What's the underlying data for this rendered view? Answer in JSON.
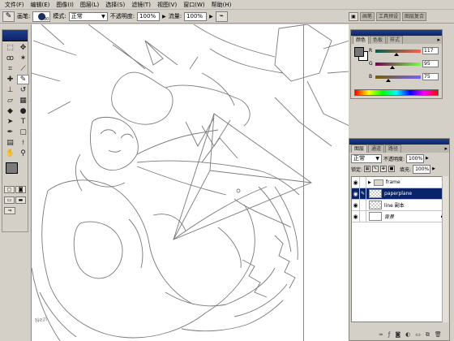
{
  "menu": [
    "文件(F)",
    "编辑(E)",
    "图像(I)",
    "图层(L)",
    "选择(S)",
    "滤镜(T)",
    "视图(V)",
    "窗口(W)",
    "帮助(H)"
  ],
  "options": {
    "brush_label": "画笔:",
    "brush_size": "30",
    "mode_label": "模式:",
    "mode_value": "正常",
    "opacity_label": "不透明度:",
    "opacity_value": "100%",
    "flow_label": "流量:",
    "flow_value": "100%"
  },
  "palette_well": [
    "画笔",
    "工具预设",
    "图层复合"
  ],
  "color_panel": {
    "tabs": [
      "颜色",
      "色板",
      "样式"
    ],
    "r_label": "R",
    "r_value": "117",
    "r_fraction": 0.459,
    "g_label": "G",
    "g_value": "95",
    "g_fraction": 0.373,
    "b_label": "B",
    "b_value": "75",
    "b_fraction": 0.294
  },
  "layers_panel": {
    "tabs": [
      "图层",
      "通道",
      "路径"
    ],
    "blend_mode": "正常",
    "opacity_label": "不透明度:",
    "opacity_value": "100%",
    "lock_label": "锁定:",
    "fill_label": "填充:",
    "fill_value": "100%",
    "layers": [
      {
        "name": "frame",
        "kind": "folder",
        "active": false
      },
      {
        "name": "paperplane",
        "kind": "layer",
        "active": true
      },
      {
        "name": "line 副本",
        "kind": "layer",
        "active": false
      },
      {
        "name": "背景",
        "kind": "background",
        "active": false
      }
    ]
  },
  "canvas": {
    "signature": "Nezi"
  },
  "colors": {
    "titlebar": "#0a246a",
    "chrome": "#d4d0c8",
    "selected_layer": "#0a246a",
    "foreground": "#757575"
  },
  "icons": [
    "brush-icon",
    "airbrush-icon",
    "eye-icon",
    "folder-icon",
    "lock-icon",
    "trash-icon"
  ]
}
